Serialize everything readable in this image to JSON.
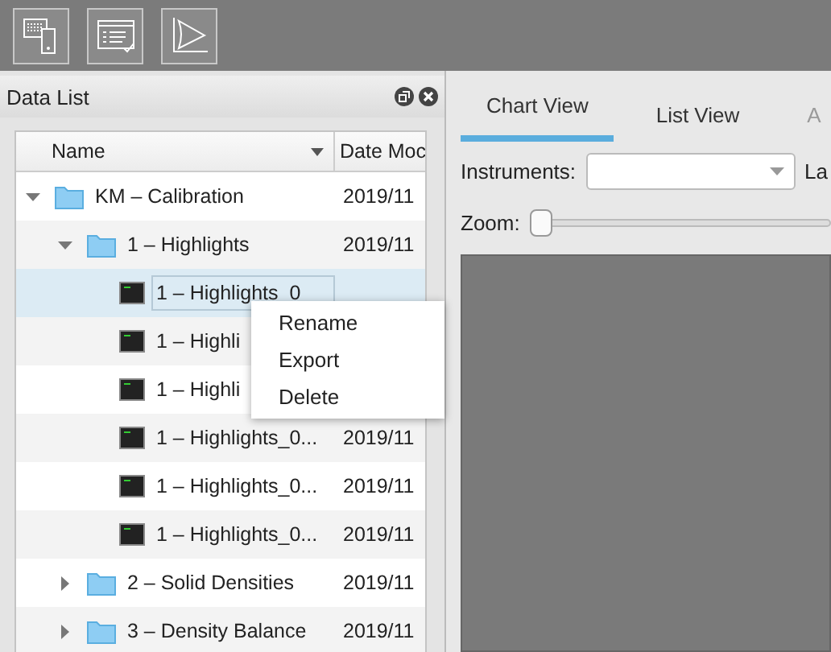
{
  "panel": {
    "title": "Data List"
  },
  "table": {
    "columns": [
      "Name",
      "Date Moc"
    ],
    "rows": [
      {
        "kind": "folder",
        "name": "KM – Calibration",
        "date": "2019/11",
        "expanded": true,
        "selected": false,
        "children": [
          {
            "kind": "folder",
            "name": "1 – Highlights",
            "date": "2019/11",
            "expanded": true,
            "selected": false,
            "children": [
              {
                "kind": "file",
                "name": "1 – Highlights_0",
                "selected": true
              },
              {
                "kind": "file",
                "name": "1 – Highli",
                "selected": false
              },
              {
                "kind": "file",
                "name": "1 – Highli",
                "selected": false
              },
              {
                "kind": "file",
                "name": "1 – Highlights_0...",
                "date": "2019/11",
                "selected": false
              },
              {
                "kind": "file",
                "name": "1 – Highlights_0...",
                "date": "2019/11",
                "selected": false
              },
              {
                "kind": "file",
                "name": "1 – Highlights_0...",
                "date": "2019/11",
                "selected": false
              }
            ]
          },
          {
            "kind": "folder",
            "name": "2 – Solid Densities",
            "date": "2019/11",
            "expanded": false,
            "selected": false
          },
          {
            "kind": "folder",
            "name": "3 – Density Balance",
            "date": "2019/11",
            "expanded": false,
            "selected": false
          }
        ]
      }
    ]
  },
  "context_menu": [
    "Rename",
    "Export",
    "Delete"
  ],
  "tabs": [
    {
      "label": "Chart View",
      "selected": true,
      "disabled": false
    },
    {
      "label": "List View",
      "selected": false,
      "disabled": false
    },
    {
      "label": "A",
      "selected": false,
      "disabled": true
    }
  ],
  "instruments": {
    "label": "Instruments:",
    "next_label": "La"
  },
  "zoom": {
    "label": "Zoom:",
    "level": 0
  }
}
